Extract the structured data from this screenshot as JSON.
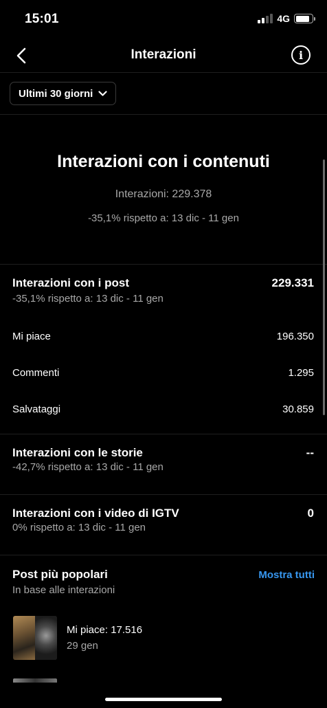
{
  "status_bar": {
    "time": "15:01",
    "network": "4G",
    "signal_bars": 4,
    "signal_bars_active": 2,
    "battery_level": 0.85
  },
  "nav": {
    "title": "Interazioni",
    "back_icon": "chevron-left-icon",
    "info_icon": "info-icon",
    "info_glyph": "i"
  },
  "filter": {
    "label": "Ultimi 30 giorni",
    "icon": "chevron-down-icon"
  },
  "summary": {
    "title": "Interazioni con i contenuti",
    "total": "Interazioni: 229.378",
    "change": "-35,1% rispetto a: 13 dic - 11 gen"
  },
  "posts": {
    "title": "Interazioni con i post",
    "value": "229.331",
    "change": "-35,1% rispetto a: 13 dic - 11 gen",
    "rows": [
      {
        "label": "Mi piace",
        "value": "196.350"
      },
      {
        "label": "Commenti",
        "value": "1.295"
      },
      {
        "label": "Salvataggi",
        "value": "30.859"
      }
    ]
  },
  "stories": {
    "title": "Interazioni con le storie",
    "value": "--",
    "change": "-42,7% rispetto a: 13 dic - 11 gen"
  },
  "igtv": {
    "title": "Interazioni con i video di IGTV",
    "value": "0",
    "change": "0% rispetto a: 13 dic - 11 gen"
  },
  "top_posts": {
    "title": "Post più popolari",
    "subtitle": "In base alle interazioni",
    "link": "Mostra tutti",
    "items": [
      {
        "likes": "Mi piace: 17.516",
        "date": "29 gen"
      }
    ]
  },
  "colors": {
    "background": "#000000",
    "secondary_text": "#a8a8a8",
    "link": "#3797f0",
    "divider": "#1f1f1f"
  }
}
